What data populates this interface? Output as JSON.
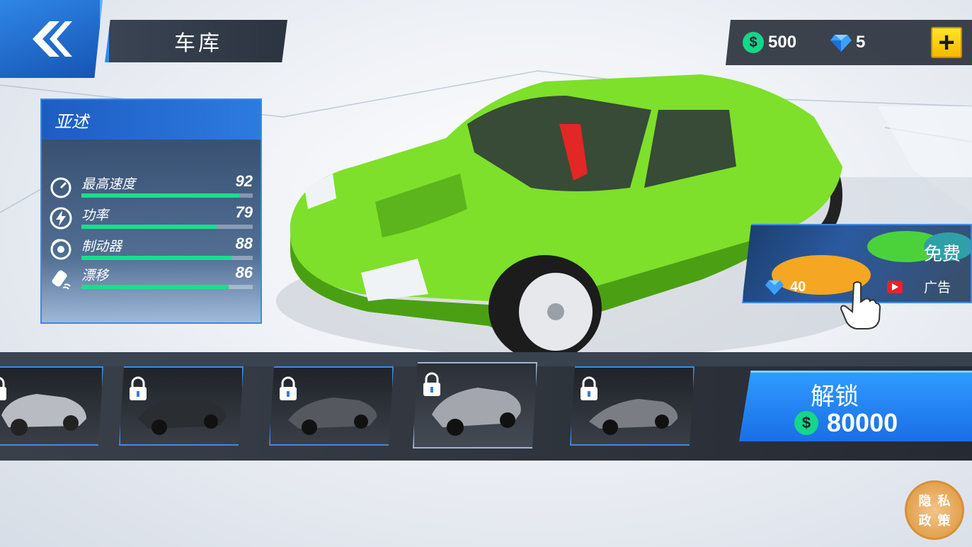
{
  "header": {
    "title": "车库"
  },
  "currency": {
    "cash": "500",
    "gems": "5",
    "cash_symbol": "$",
    "add_symbol": "+"
  },
  "car": {
    "name": "亚述",
    "body_color": "#7ee02a",
    "stats": [
      {
        "label": "最高速度",
        "value": "92",
        "icon": "speedometer-icon",
        "fill": 0.92
      },
      {
        "label": "功率",
        "value": "79",
        "icon": "lightning-icon",
        "fill": 0.79
      },
      {
        "label": "制动器",
        "value": "88",
        "icon": "brake-disc-icon",
        "fill": 0.88
      },
      {
        "label": "漂移",
        "value": "86",
        "icon": "drift-car-icon",
        "fill": 0.86
      }
    ]
  },
  "ad_offer": {
    "free_label": "免费",
    "gems": "40",
    "ad_label": "广告"
  },
  "garage": {
    "cars": [
      {
        "locked": true,
        "selected": false
      },
      {
        "locked": true,
        "selected": false
      },
      {
        "locked": true,
        "selected": false
      },
      {
        "locked": true,
        "selected": true
      },
      {
        "locked": true,
        "selected": false
      }
    ]
  },
  "unlock": {
    "label": "解锁",
    "price": "80000",
    "cash_symbol": "$"
  },
  "privacy": {
    "chars": [
      "隐",
      "私",
      "政",
      "策"
    ]
  },
  "colors": {
    "accent": "#2e8cf0",
    "cash": "#16d68a",
    "gem": "#3aa0ff",
    "stat_bar": "#18e08a"
  }
}
